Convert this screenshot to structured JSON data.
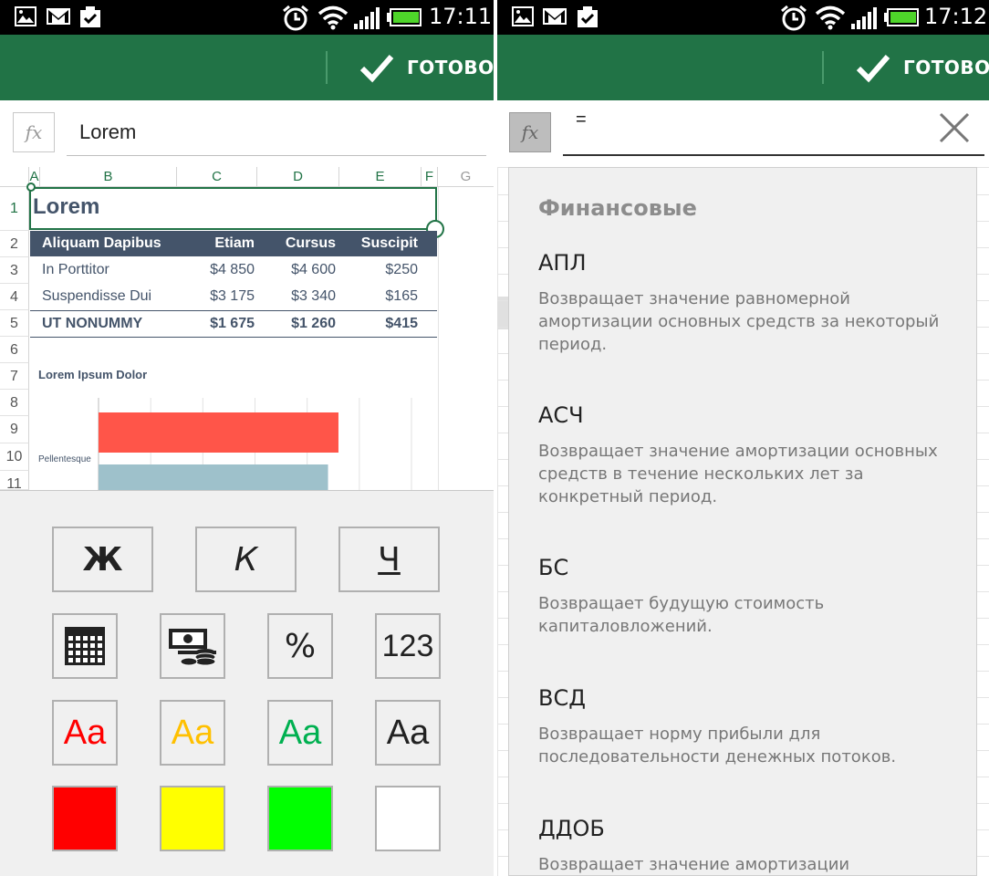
{
  "left": {
    "status": {
      "time": "17:11"
    },
    "appbar": {
      "done_label": "ГОТОВО"
    },
    "formula": {
      "fx_label": "fx",
      "value": "Lorem"
    },
    "columns": [
      "A",
      "B",
      "C",
      "D",
      "E",
      "F",
      "G"
    ],
    "rows": [
      "1",
      "2",
      "3",
      "4",
      "5",
      "6",
      "7",
      "8",
      "9",
      "10",
      "11"
    ],
    "sheet": {
      "title": "Lorem",
      "table_header": [
        "Aliquam Dapibus",
        "Etiam",
        "Cursus",
        "Suscipit"
      ],
      "table_rows": [
        [
          "In Porttitor",
          "$4 850",
          "$4 600",
          "$250"
        ],
        [
          "Suspendisse Dui",
          "$3 175",
          "$3 340",
          "$165"
        ]
      ],
      "table_total": [
        "UT NONUMMY",
        "$1 675",
        "$1 260",
        "$415"
      ],
      "header_color": "#44546a"
    },
    "chart_data": {
      "type": "bar",
      "title": "Lorem Ipsum Dolor",
      "categories": [
        "Pellentesque"
      ],
      "series": [
        {
          "values": [
            4600
          ],
          "color": "#ff5549"
        },
        {
          "values": [
            4400
          ],
          "color": "#9ec1cb"
        }
      ],
      "xlim": [
        0,
        6000
      ],
      "grid": true
    },
    "toolbar": {
      "format_buttons": [
        {
          "label": "Ж",
          "style": "bold"
        },
        {
          "label": "К",
          "style": "italic"
        },
        {
          "label": "Ч",
          "style": "underline"
        }
      ],
      "number_buttons": [
        {
          "icon": "calendar-icon"
        },
        {
          "icon": "money-icon"
        },
        {
          "label": "%"
        },
        {
          "label": "123"
        }
      ],
      "font_colors": [
        {
          "label": "Aa",
          "color": "#ff0000"
        },
        {
          "label": "Aa",
          "color": "#ffc000"
        },
        {
          "label": "Aa",
          "color": "#00b050"
        },
        {
          "label": "Aa",
          "color": "#222222"
        }
      ],
      "fill_colors": [
        "#ff0000",
        "#ffff00",
        "#00ff00",
        "#ffffff"
      ]
    }
  },
  "right": {
    "status": {
      "time": "17:12"
    },
    "appbar": {
      "done_label": "ГОТОВО"
    },
    "formula": {
      "fx_label": "fx",
      "value": "="
    },
    "function_list": {
      "category": "Финансовые",
      "functions": [
        {
          "name": "АПЛ",
          "description": "Возвращает значение равномерной амортизации основных средств за некоторый период."
        },
        {
          "name": "АСЧ",
          "description": "Возвращает значение амортизации основных средств в течение нескольких лет за конкретный период."
        },
        {
          "name": "БС",
          "description": "Возвращает будущую стоимость капиталовложений."
        },
        {
          "name": "ВСД",
          "description": "Возвращает норму прибыли для последовательности денежных потоков."
        },
        {
          "name": "ДДОБ",
          "description": "Возвращает значение амортизации"
        }
      ]
    }
  }
}
